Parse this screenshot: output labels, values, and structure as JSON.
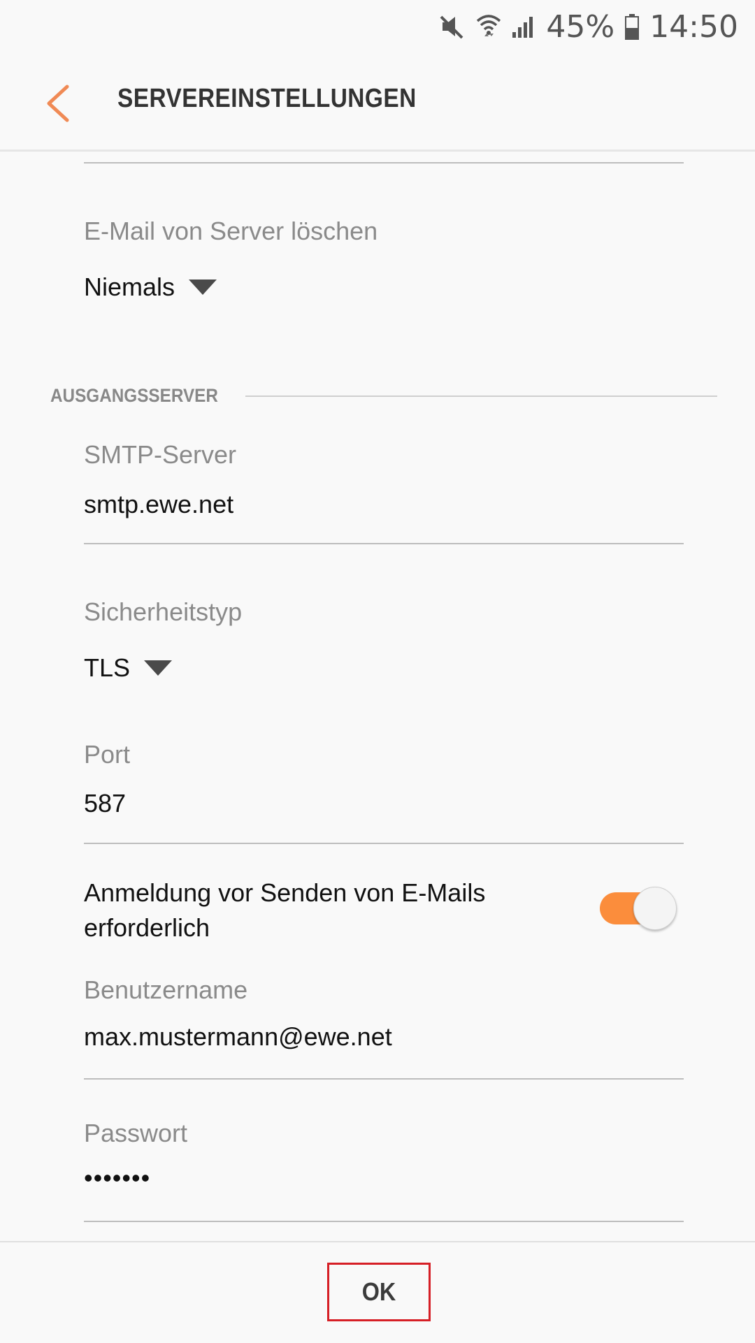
{
  "status_bar": {
    "battery_percent": "45%",
    "time": "14:50",
    "icons": [
      "mute-icon",
      "wifi-icon",
      "signal-icon",
      "battery-icon"
    ]
  },
  "appbar": {
    "title": "SERVEREINSTELLUNGEN",
    "back_icon": "chevron-left-icon"
  },
  "delete_from_server": {
    "label": "E-Mail von Server löschen",
    "value": "Niemals"
  },
  "outgoing_section": {
    "title": "AUSGANGSSERVER"
  },
  "smtp_server": {
    "label": "SMTP-Server",
    "value": "smtp.ewe.net"
  },
  "security_type": {
    "label": "Sicherheitstyp",
    "value": "TLS"
  },
  "port": {
    "label": "Port",
    "value": "587"
  },
  "login_required": {
    "label": "Anmeldung vor Senden von E-Mails erforderlich",
    "enabled": true
  },
  "username": {
    "label": "Benutzername",
    "value": "max.mustermann@ewe.net"
  },
  "password": {
    "label": "Passwort",
    "value": "•••••••"
  },
  "bottom": {
    "ok_label": "OK"
  },
  "colors": {
    "accent": "#fb8d3c",
    "highlight_border": "#d61f26"
  }
}
